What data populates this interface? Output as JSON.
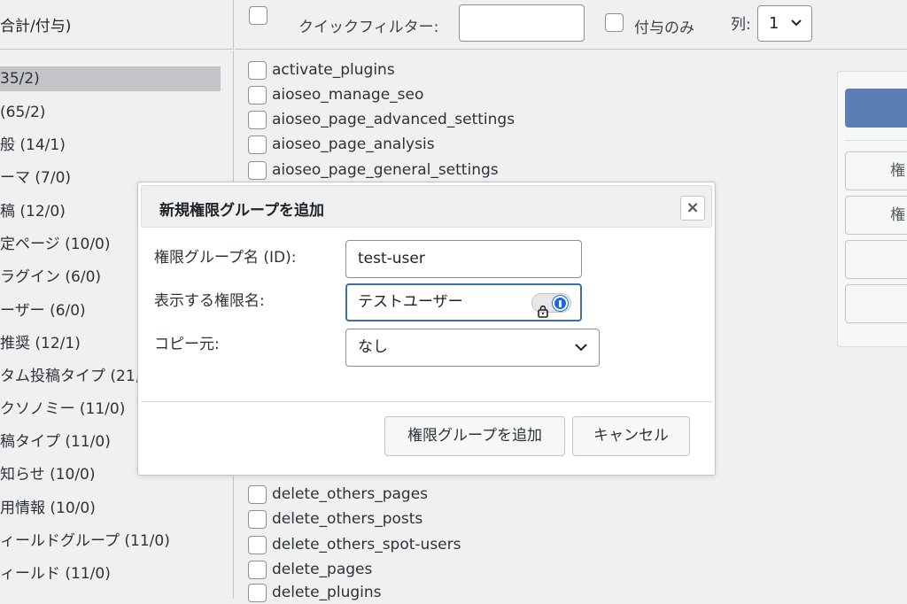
{
  "header": {
    "left_label": "合計/付与)",
    "quick_filter_label": "クイックフィルター:",
    "quick_filter_value": "",
    "granted_only_label": "付与のみ",
    "columns_label": "列:",
    "columns_value": "1"
  },
  "groups": [
    "35/2)",
    "(65/2)",
    "般 (14/1)",
    "ーマ (7/0)",
    "稿 (12/0)",
    "定ページ (10/0)",
    "ラグイン (6/0)",
    "ーザー (6/0)",
    "推奨 (12/1)",
    "タム投稿タイプ (21,",
    "クソノミー (11/0)",
    "稿タイプ (11/0)",
    "知らせ (10/0)",
    "用情報 (10/0)",
    "ィールドグループ (11/0)",
    "ィールド (11/0)"
  ],
  "capabilities": [
    "activate_plugins",
    "aioseo_manage_seo",
    "aioseo_page_advanced_settings",
    "aioseo_page_analysis",
    "aioseo_page_general_settings",
    "delete_others_pages",
    "delete_others_posts",
    "delete_others_spot-users",
    "delete_pages",
    "delete_plugins"
  ],
  "side_buttons": [
    "権",
    "権"
  ],
  "modal": {
    "title": "新規権限グループを追加",
    "close_label": "×",
    "id_label": "権限グループ名 (ID):",
    "id_value": "test-user",
    "display_label": "表示する権限名:",
    "display_value": "テストユーザー",
    "copy_label": "コピー元:",
    "copy_value": "なし",
    "add_button": "権限グループを追加",
    "cancel_button": "キャンセル"
  },
  "colors": {
    "accent": "#5b7eb4",
    "focus_border": "#3c6ea8",
    "password_manager": "#1a6ad6"
  }
}
